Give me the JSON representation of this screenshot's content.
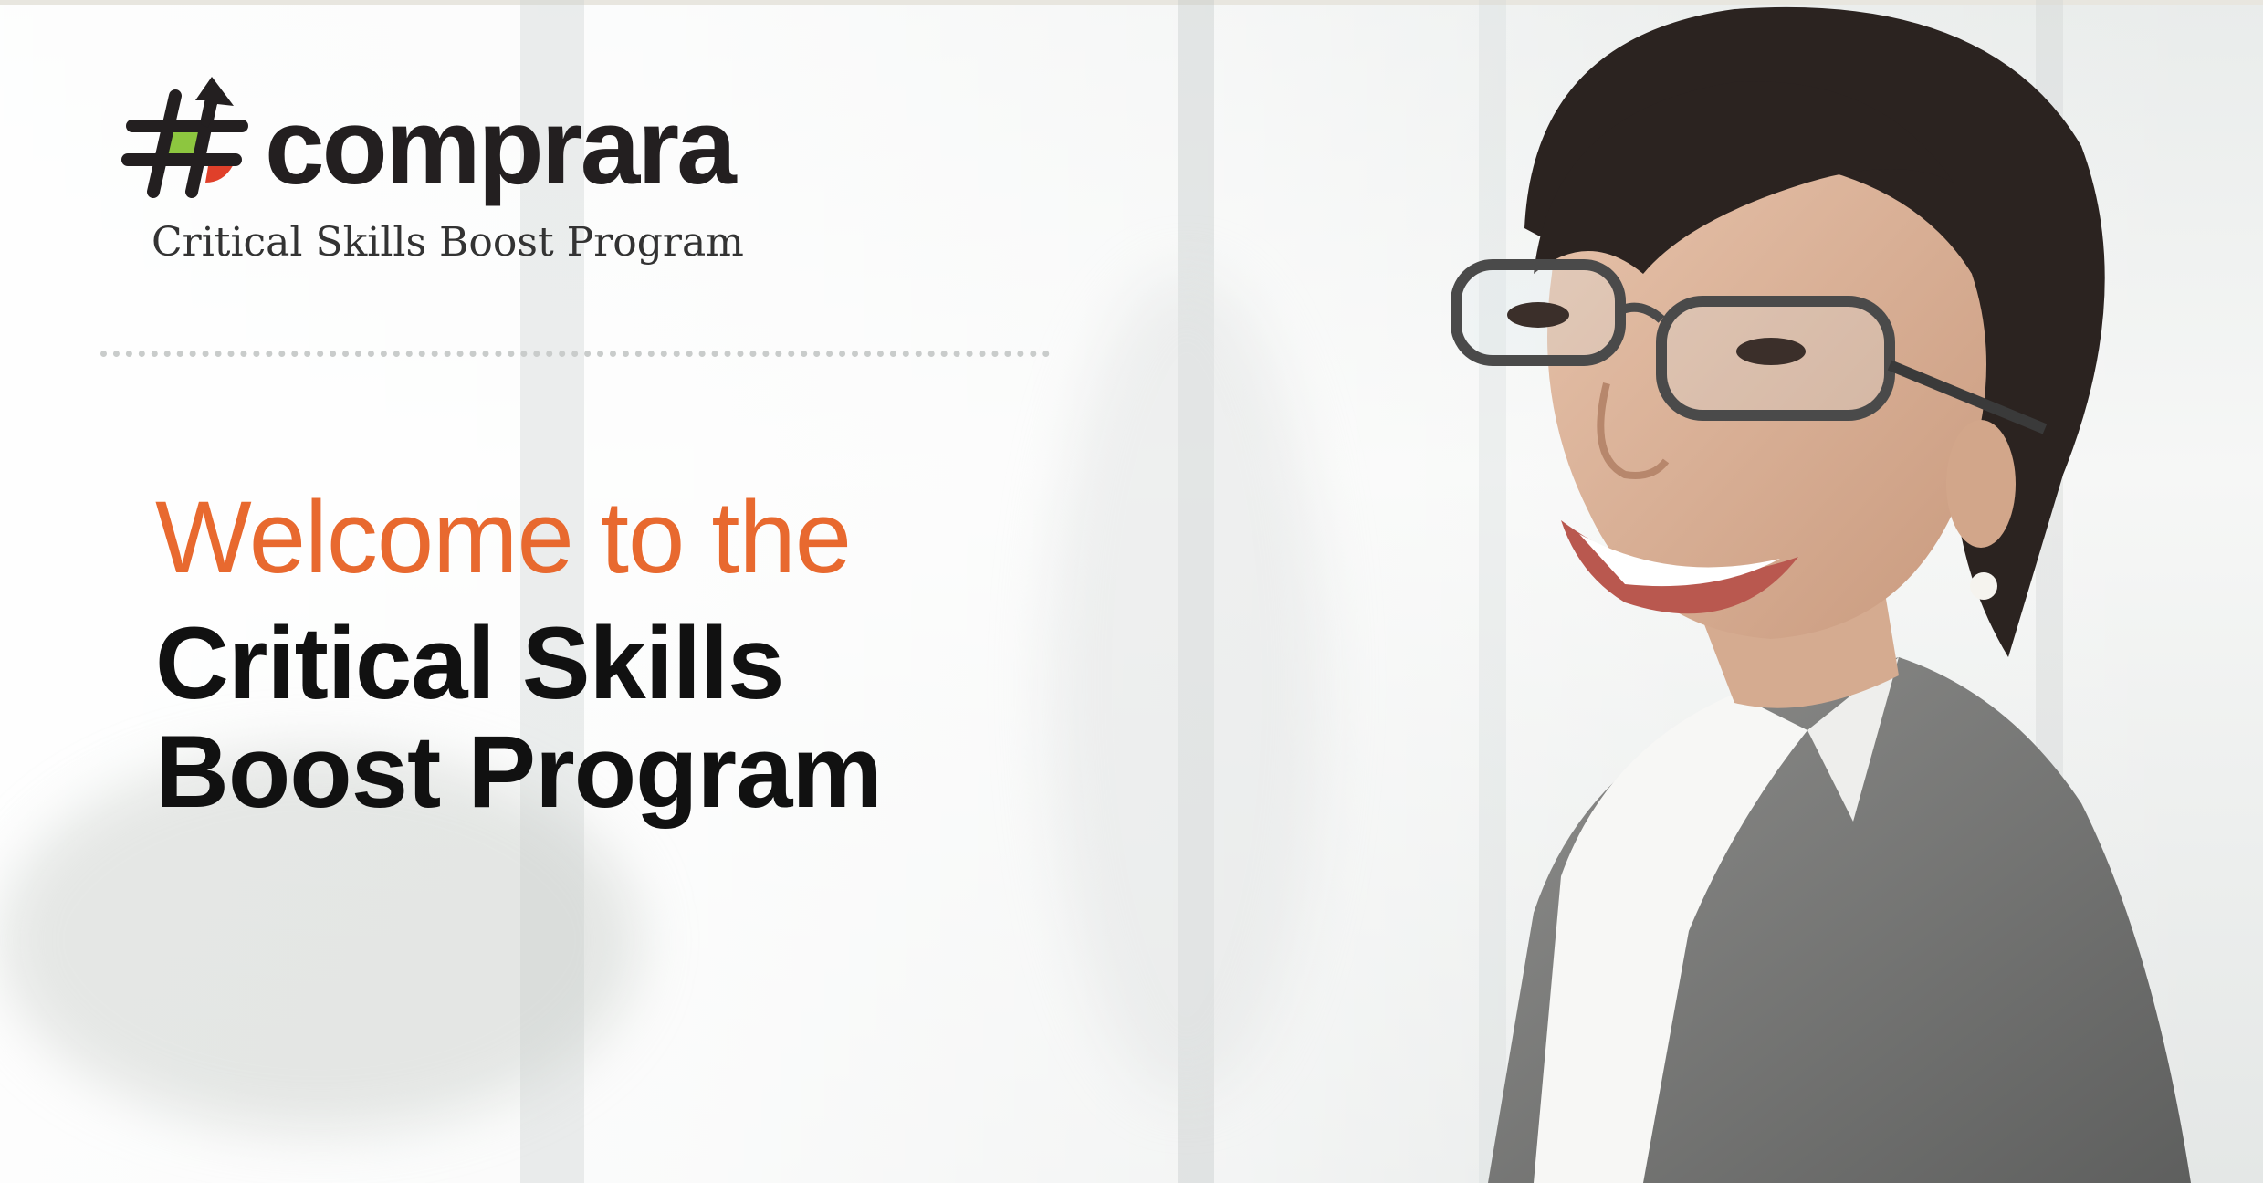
{
  "brand": {
    "name": "comprara",
    "tagline": "Critical Skills Boost Program",
    "colors": {
      "accent_orange": "#e8692f",
      "logo_green": "#8dc63f",
      "logo_red": "#e0402a",
      "dark": "#231f20"
    }
  },
  "hero": {
    "welcome_line": "Welcome to the",
    "headline_line1": "Critical Skills",
    "headline_line2": "Boost Program"
  },
  "icons": {
    "logo_mark": "hash-arrow-logo-icon"
  },
  "image": {
    "subject": "smiling-woman-with-glasses-photo"
  }
}
